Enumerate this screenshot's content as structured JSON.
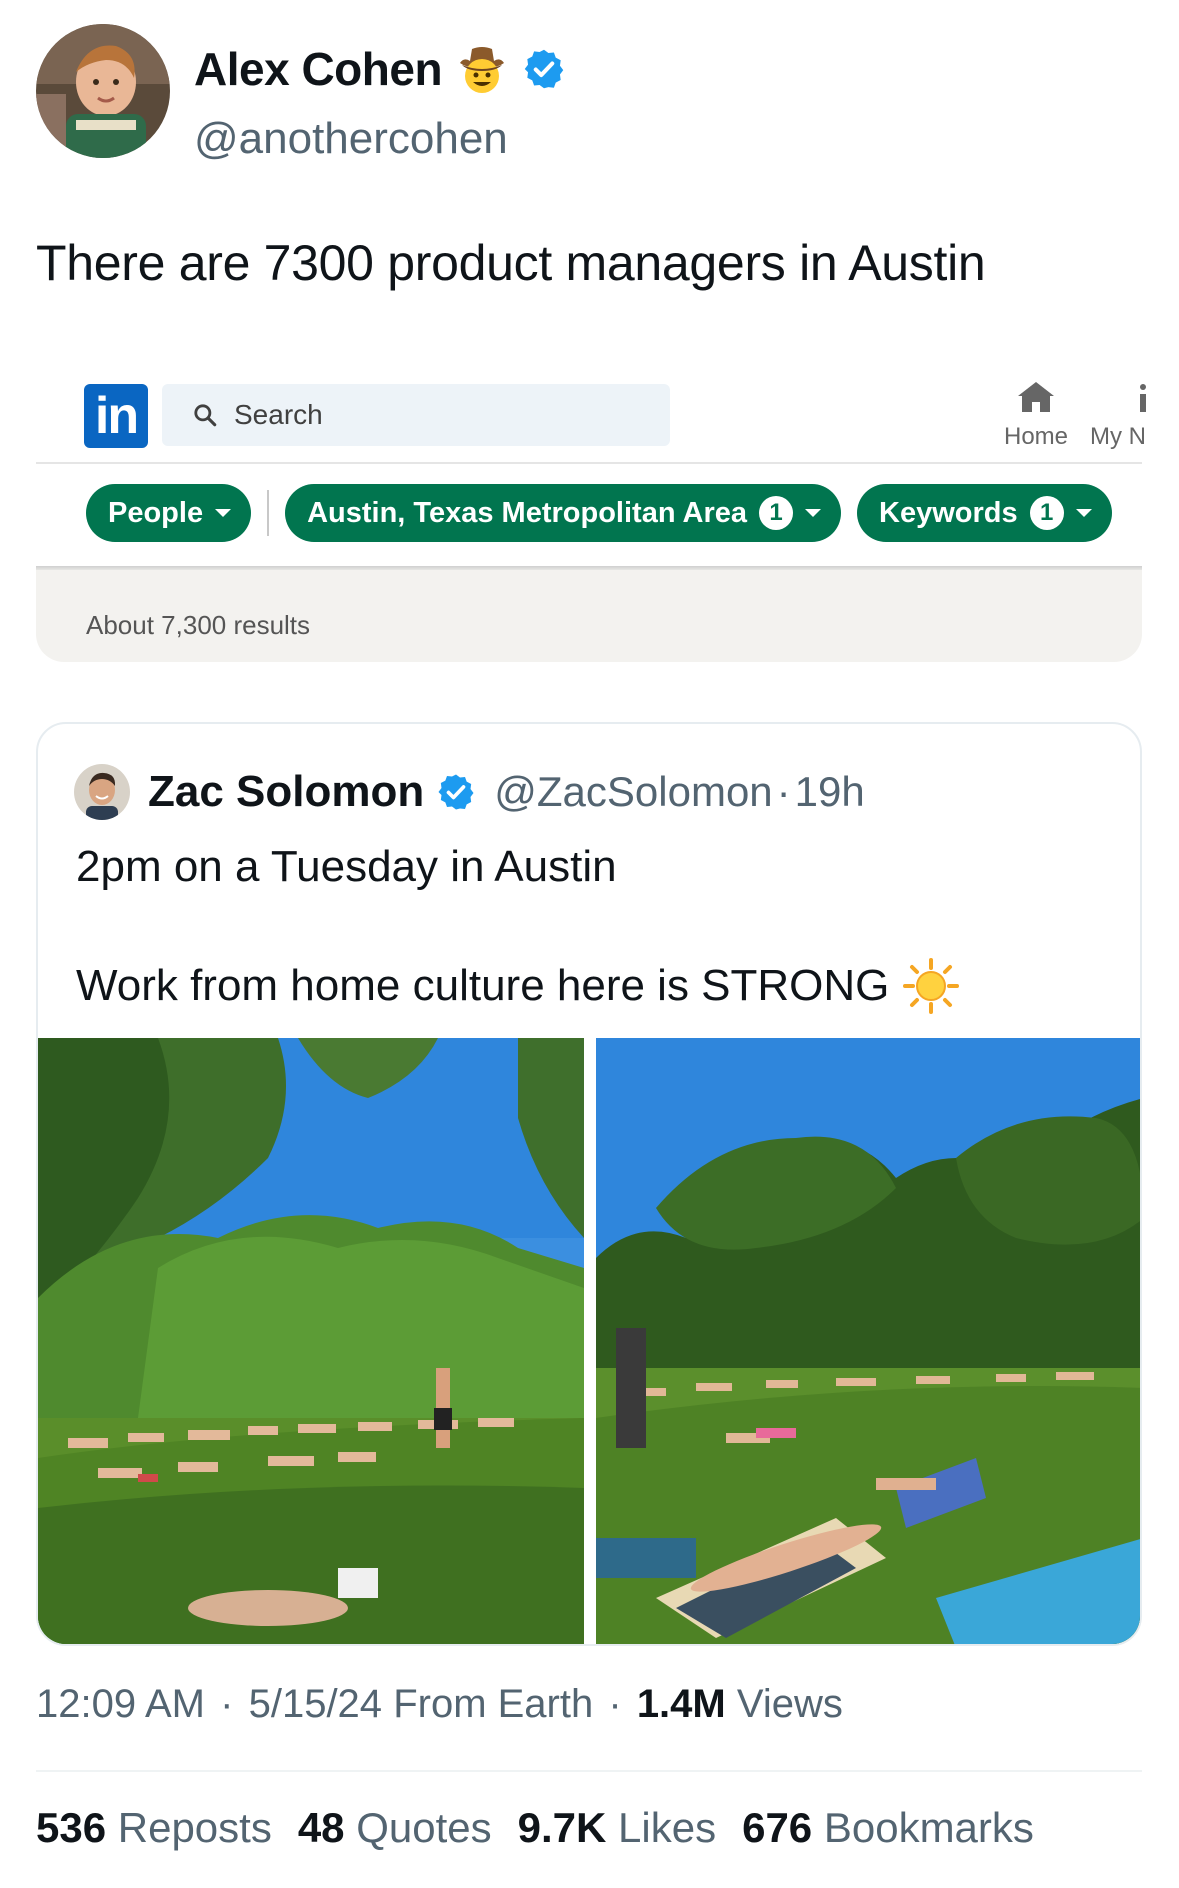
{
  "author": {
    "name": "Alex Cohen",
    "handle": "@anothercohen",
    "emoji": "cowboy-hat-face-emoji",
    "verified_icon": "verified-badge-icon"
  },
  "tweet": {
    "text": "There are 7300 product managers in Austin"
  },
  "linkedin": {
    "logo": "in",
    "search_placeholder": "Search",
    "nav": {
      "home_label": "Home",
      "my_network_label": "My N"
    },
    "filters": [
      {
        "label": "People",
        "count": null
      },
      {
        "label": "Austin, Texas Metropolitan Area",
        "count": "1"
      },
      {
        "label": "Keywords",
        "count": "1"
      }
    ],
    "results_text": "About 7,300 results"
  },
  "quoted": {
    "name": "Zac Solomon",
    "handle": "@ZacSolomon",
    "separator": "·",
    "time": "19h",
    "line1": "2pm on a Tuesday in Austin",
    "line2": "Work from home culture here is STRONG",
    "emoji": "sun-emoji",
    "photos": [
      "park-sunbathers-photo-1",
      "park-sunbathers-photo-2"
    ]
  },
  "meta": {
    "time": "12:09 AM",
    "sep1": "·",
    "date": "5/15/24",
    "source": "From Earth",
    "sep2": "·",
    "views_count": "1.4M",
    "views_label": "Views"
  },
  "stats": {
    "reposts_count": "536",
    "reposts_label": "Reposts",
    "quotes_count": "48",
    "quotes_label": "Quotes",
    "likes_count": "9.7K",
    "likes_label": "Likes",
    "bookmarks_count": "676",
    "bookmarks_label": "Bookmarks"
  },
  "colors": {
    "linkedin_blue": "#0a66c2",
    "linkedin_green": "#01754f",
    "x_verified_blue": "#1d9bf0",
    "secondary_text": "#536471"
  }
}
